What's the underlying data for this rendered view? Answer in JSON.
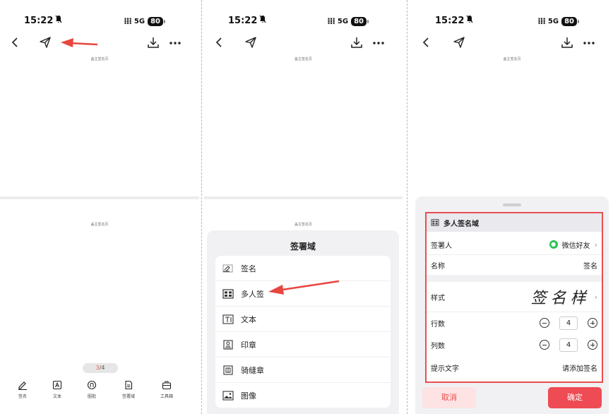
{
  "status": {
    "time": "15:22",
    "network": "5G",
    "battery": "80"
  },
  "doc": {
    "page_header": "盖主签名页"
  },
  "pager": {
    "current": "3",
    "total": "/4"
  },
  "tabbar": [
    "签名",
    "文本",
    "圈批",
    "签署域",
    "工具箱"
  ],
  "sheet": {
    "title": "签署域",
    "items": [
      "签名",
      "多人签",
      "文本",
      "印章",
      "骑缝章",
      "图像"
    ]
  },
  "form": {
    "header": "多人签名域",
    "signer_label": "签署人",
    "signer_value": "微信好友",
    "name_label": "名称",
    "name_value": "签名",
    "style_label": "样式",
    "style_value": "签名样",
    "rows_label": "行数",
    "rows_value": "4",
    "cols_label": "列数",
    "cols_value": "4",
    "hint_label": "提示文字",
    "hint_value": "请添加签名",
    "cancel": "取消",
    "confirm": "确定"
  },
  "colors": {
    "accent": "#ef4b55",
    "highlight": "#e84e4e",
    "wechat": "#2bc253"
  },
  "icons": [
    "back-icon",
    "send-icon",
    "download-icon",
    "more-icon",
    "bell-mute-icon"
  ]
}
